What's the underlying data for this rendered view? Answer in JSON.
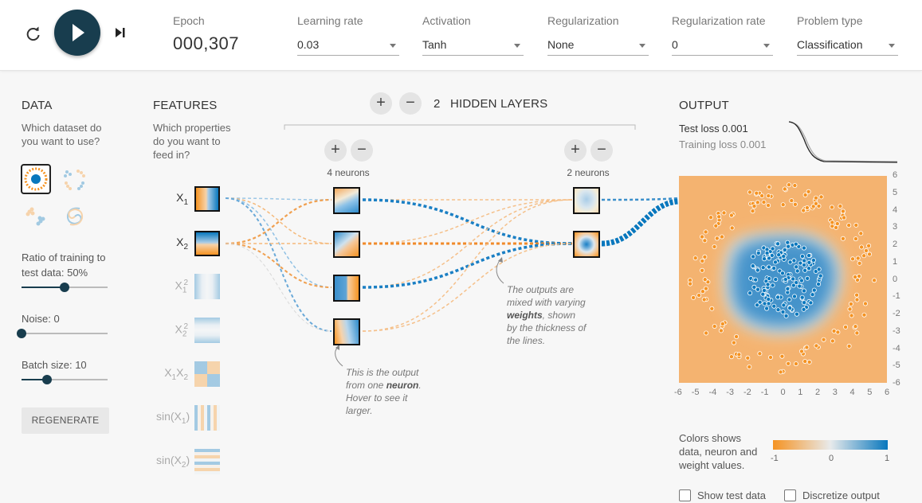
{
  "topbar": {
    "epoch_label": "Epoch",
    "epoch_value": "000,307",
    "learning_rate_label": "Learning rate",
    "learning_rate_value": "0.03",
    "activation_label": "Activation",
    "activation_value": "Tanh",
    "regularization_label": "Regularization",
    "regularization_value": "None",
    "regularization_rate_label": "Regularization rate",
    "regularization_rate_value": "0",
    "problem_type_label": "Problem type",
    "problem_type_value": "Classification",
    "icons": [
      "reset-icon",
      "play-icon",
      "step-icon",
      "chevron-down-icon"
    ]
  },
  "data_panel": {
    "heading": "DATA",
    "question_line1": "Which dataset do",
    "question_line2": "you want to use?",
    "datasets": [
      "circle",
      "xor",
      "gaussian",
      "spiral"
    ],
    "selected_dataset": "circle",
    "ratio_label_line1": "Ratio of training to",
    "ratio_label_line2": "test data:  50%",
    "ratio_value": 0.5,
    "noise_label": "Noise:  0",
    "noise_value": 0,
    "batch_label": "Batch size:  10",
    "batch_value": 0.3,
    "regenerate_label": "REGENERATE"
  },
  "features_panel": {
    "heading": "FEATURES",
    "question_line1": "Which properties",
    "question_line2": "do you want to",
    "question_line3": "feed in?",
    "features": [
      {
        "base": "X",
        "sub": "1",
        "sup": "",
        "pre": "",
        "post": "",
        "active": true
      },
      {
        "base": "X",
        "sub": "2",
        "sup": "",
        "pre": "",
        "post": "",
        "active": true
      },
      {
        "base": "X",
        "sub": "1",
        "sup": "2",
        "pre": "",
        "post": "",
        "active": false
      },
      {
        "base": "X",
        "sub": "2",
        "sup": "2",
        "pre": "",
        "post": "",
        "active": false
      },
      {
        "base": "X",
        "sub": "1",
        "sup": "",
        "pre": "",
        "post": "X",
        "active": false
      },
      {
        "base": "sin(X",
        "sub": "1",
        "sup": "",
        "pre": "",
        "post": ")",
        "active": false
      },
      {
        "base": "sin(X",
        "sub": "2",
        "sup": "",
        "pre": "",
        "post": ")",
        "active": false
      }
    ]
  },
  "network": {
    "plus": "+",
    "minus": "−",
    "hidden_layers_count": "2",
    "hidden_layers_label": "HIDDEN LAYERS",
    "layer1_neurons": "4 neurons",
    "layer2_neurons": "2 neurons",
    "note_neuron_pre": "This is the output from one",
    "note_neuron_bold": "neuron",
    "note_neuron_post": ". Hover to see it larger.",
    "note_weights_pre": "The outputs are mixed with varying",
    "note_weights_bold": "weights",
    "note_weights_post": ", shown by the thickness of the lines."
  },
  "output_panel": {
    "heading": "OUTPUT",
    "test_loss_label": "Test loss 0.001",
    "training_loss_label": "Training loss 0.001",
    "x_ticks": [
      "-6",
      "-5",
      "-4",
      "-3",
      "-2",
      "-1",
      "0",
      "1",
      "2",
      "3",
      "4",
      "5",
      "6"
    ],
    "y_ticks": [
      "6",
      "5",
      "4",
      "3",
      "2",
      "1",
      "0",
      "-1",
      "-2",
      "-3",
      "-4",
      "-5",
      "-6"
    ],
    "legend_line1": "Colors shows",
    "legend_line2": "data, neuron and",
    "legend_line3": "weight values.",
    "colorbar_min": "-1",
    "colorbar_mid": "0",
    "colorbar_max": "1",
    "show_test_data_label": "Show test data",
    "show_test_data_checked": false,
    "discretize_label": "Discretize output",
    "discretize_checked": false
  },
  "colors": {
    "positive": "#0877bd",
    "negative": "#f59322",
    "neutral": "#e8eaeb",
    "play_button": "#183d4e"
  }
}
